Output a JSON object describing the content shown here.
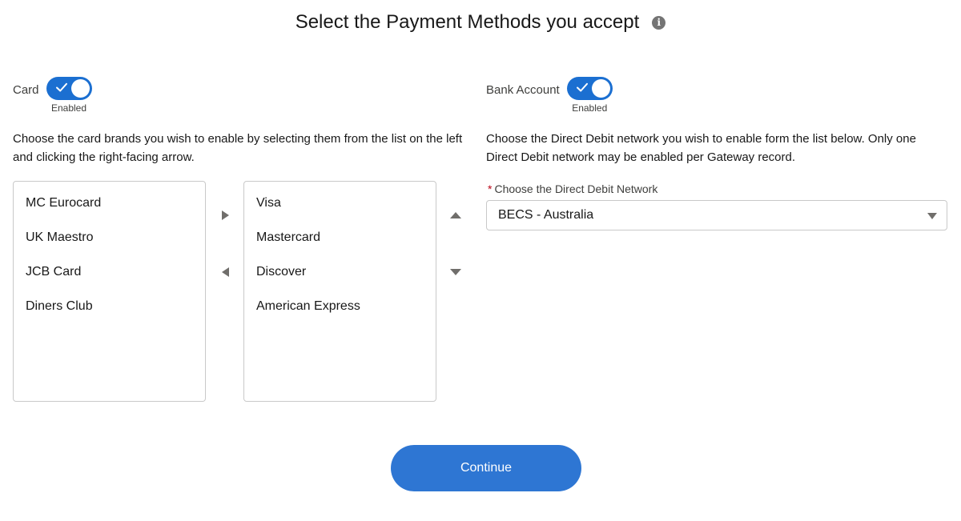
{
  "page": {
    "title": "Select the Payment Methods you accept",
    "info_icon": "i"
  },
  "card": {
    "label": "Card",
    "toggle_checked": true,
    "status": "Enabled",
    "description": "Choose the card brands you wish to enable by selecting them from the list on the left and clicking the right-facing arrow.",
    "available": [
      "MC Eurocard",
      "UK Maestro",
      "JCB Card",
      "Diners Club"
    ],
    "selected": [
      "Visa",
      "Mastercard",
      "Discover",
      "American Express"
    ]
  },
  "bank": {
    "label": "Bank Account",
    "toggle_checked": true,
    "status": "Enabled",
    "description": "Choose the Direct Debit network you wish to enable form the list below. Only one Direct Debit network may be enabled per Gateway record.",
    "field_required_mark": "*",
    "field_label": "Choose the Direct Debit Network",
    "field_value": "BECS - Australia"
  },
  "footer": {
    "continue_label": "Continue"
  },
  "colors": {
    "toggle_on": "#1b6fd1",
    "primary_button": "#2e76d3",
    "required": "#ba0517"
  },
  "icons": {
    "info": "info-icon",
    "check": "check-icon",
    "move_right": "chevron-right-icon",
    "move_left": "chevron-left-icon",
    "move_up": "chevron-up-icon",
    "move_down": "chevron-down-icon",
    "dropdown": "caret-down-icon"
  }
}
